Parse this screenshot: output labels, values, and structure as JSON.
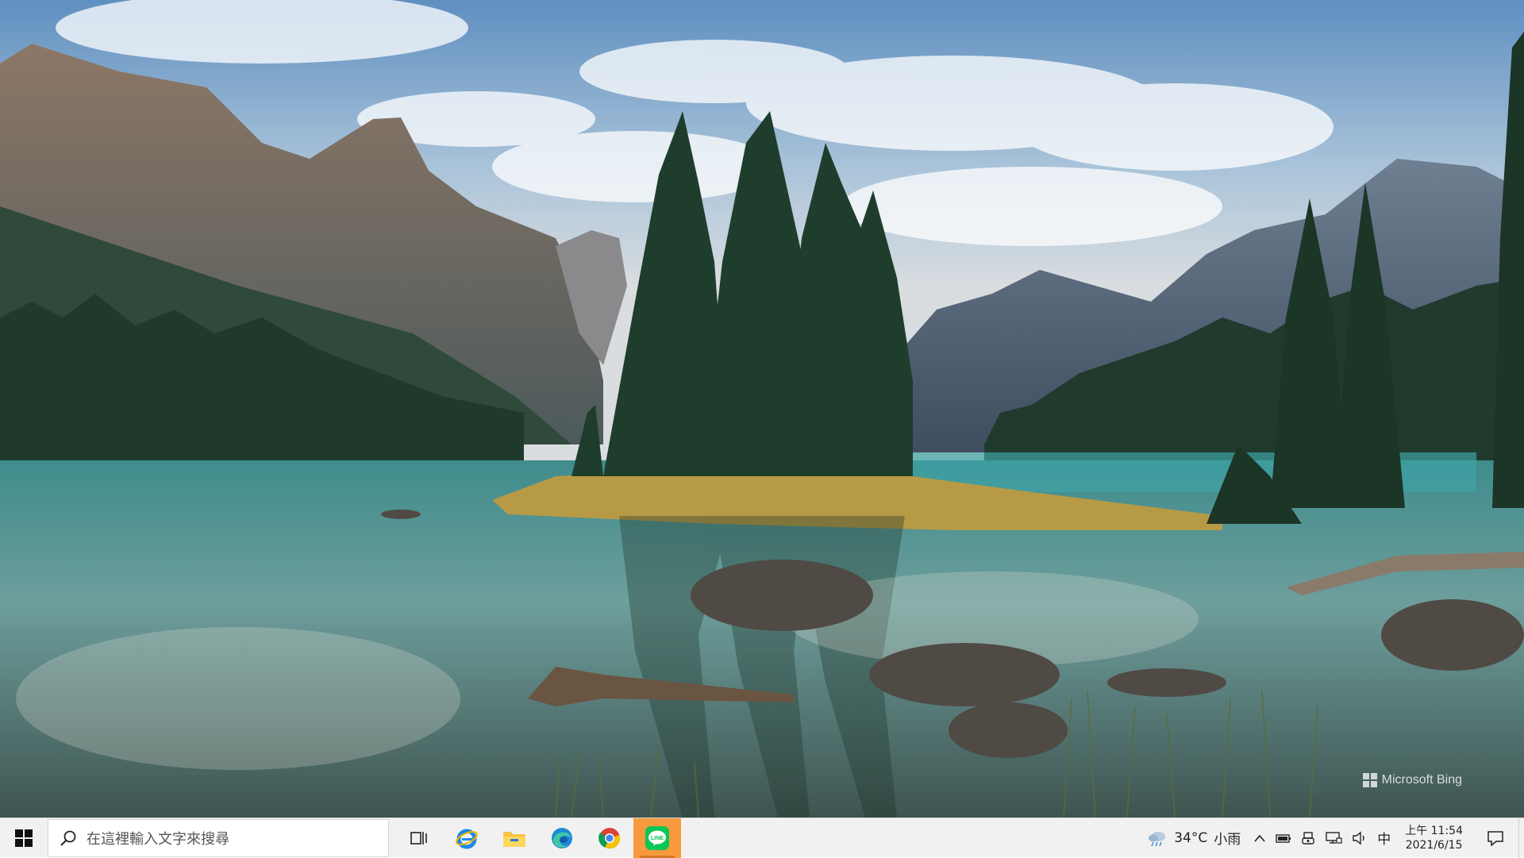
{
  "desktop": {
    "wallpaper": "mountain-lake-forest-photo",
    "watermark": {
      "text": "Microsoft Bing",
      "icon": "bing-logo-icon"
    }
  },
  "taskbar": {
    "start_icon": "windows-logo-icon",
    "search": {
      "icon": "search-icon",
      "placeholder": "在這裡輸入文字來搜尋"
    },
    "task_view_icon": "task-view-icon",
    "pinned_apps": [
      {
        "name": "internet-explorer",
        "icon": "internet-explorer-icon",
        "state": "pinned"
      },
      {
        "name": "file-explorer",
        "icon": "folder-icon",
        "state": "pinned"
      },
      {
        "name": "microsoft-edge",
        "icon": "edge-icon",
        "state": "pinned"
      },
      {
        "name": "google-chrome",
        "icon": "chrome-icon",
        "state": "pinned"
      },
      {
        "name": "line",
        "icon": "line-icon",
        "label": "LINE",
        "state": "active"
      }
    ],
    "tray": {
      "weather": {
        "icon": "weather-icon",
        "temperature": "34°C",
        "condition": "小雨"
      },
      "icons": [
        "chevron-up-icon",
        "battery-icon",
        "usb-device-icon",
        "network-icon",
        "volume-icon"
      ],
      "ime": "中",
      "clock": {
        "time": "上午 11:54",
        "date": "2021/6/15"
      },
      "notification_icon": "notification-icon"
    },
    "colors": {
      "background": "#f1f1f1",
      "active_app": "#f79a3e",
      "line_green": "#06c755"
    }
  }
}
